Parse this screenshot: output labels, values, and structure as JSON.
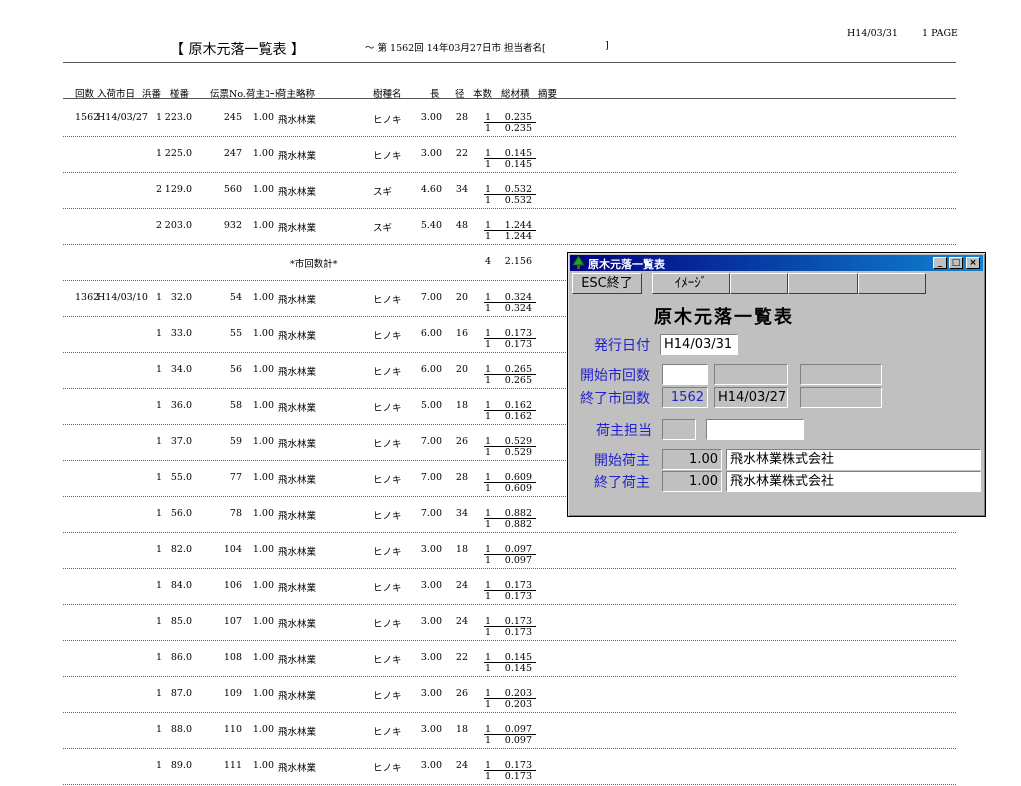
{
  "report": {
    "title": "【 原木元落一覧表 】",
    "subtitle": "～ 第 1562回 14年03月27日市 担当者名[",
    "subtitle_end": "]",
    "print_date": "H14/03/31",
    "page": "1 PAGE"
  },
  "columns": [
    "回数",
    "入荷市日",
    "浜番",
    "椪番",
    "伝票No.",
    "荷主ｺｰﾄﾞ",
    "荷主略称",
    "樹種名",
    "長",
    "径",
    "本数",
    "総材積",
    "摘要"
  ],
  "rows": [
    {
      "kai": "1562",
      "date": "H14/03/27",
      "hama": "1",
      "hai": "223.0",
      "den": "245",
      "code": "1.00",
      "name": "飛水林業",
      "species": "ヒノキ",
      "len": "3.00",
      "dia": "28",
      "qty": "1",
      "vol": "0.235",
      "qty2": "1",
      "vol2": "0.235"
    },
    {
      "kai": "",
      "date": "",
      "hama": "1",
      "hai": "225.0",
      "den": "247",
      "code": "1.00",
      "name": "飛水林業",
      "species": "ヒノキ",
      "len": "3.00",
      "dia": "22",
      "qty": "1",
      "vol": "0.145",
      "qty2": "1",
      "vol2": "0.145"
    },
    {
      "kai": "",
      "date": "",
      "hama": "2",
      "hai": "129.0",
      "den": "560",
      "code": "1.00",
      "name": "飛水林業",
      "species": "スギ",
      "len": "4.60",
      "dia": "34",
      "qty": "1",
      "vol": "0.532",
      "qty2": "1",
      "vol2": "0.532"
    },
    {
      "kai": "",
      "date": "",
      "hama": "2",
      "hai": "203.0",
      "den": "932",
      "code": "1.00",
      "name": "飛水林業",
      "species": "スギ",
      "len": "5.40",
      "dia": "48",
      "qty": "1",
      "vol": "1.244",
      "qty2": "1",
      "vol2": "1.244"
    },
    {
      "subtotal": true,
      "label": "*市回数計*",
      "qty": "4",
      "vol": "2.156"
    },
    {
      "kai": "1362",
      "date": "H14/03/10",
      "hama": "1",
      "hai": "32.0",
      "den": "54",
      "code": "1.00",
      "name": "飛水林業",
      "species": "ヒノキ",
      "len": "7.00",
      "dia": "20",
      "qty": "1",
      "vol": "0.324",
      "qty2": "1",
      "vol2": "0.324"
    },
    {
      "kai": "",
      "date": "",
      "hama": "1",
      "hai": "33.0",
      "den": "55",
      "code": "1.00",
      "name": "飛水林業",
      "species": "ヒノキ",
      "len": "6.00",
      "dia": "16",
      "qty": "1",
      "vol": "0.173",
      "qty2": "1",
      "vol2": "0.173"
    },
    {
      "kai": "",
      "date": "",
      "hama": "1",
      "hai": "34.0",
      "den": "56",
      "code": "1.00",
      "name": "飛水林業",
      "species": "ヒノキ",
      "len": "6.00",
      "dia": "20",
      "qty": "1",
      "vol": "0.265",
      "qty2": "1",
      "vol2": "0.265"
    },
    {
      "kai": "",
      "date": "",
      "hama": "1",
      "hai": "36.0",
      "den": "58",
      "code": "1.00",
      "name": "飛水林業",
      "species": "ヒノキ",
      "len": "5.00",
      "dia": "18",
      "qty": "1",
      "vol": "0.162",
      "qty2": "1",
      "vol2": "0.162"
    },
    {
      "kai": "",
      "date": "",
      "hama": "1",
      "hai": "37.0",
      "den": "59",
      "code": "1.00",
      "name": "飛水林業",
      "species": "ヒノキ",
      "len": "7.00",
      "dia": "26",
      "qty": "1",
      "vol": "0.529",
      "qty2": "1",
      "vol2": "0.529"
    },
    {
      "kai": "",
      "date": "",
      "hama": "1",
      "hai": "55.0",
      "den": "77",
      "code": "1.00",
      "name": "飛水林業",
      "species": "ヒノキ",
      "len": "7.00",
      "dia": "28",
      "qty": "1",
      "vol": "0.609",
      "qty2": "1",
      "vol2": "0.609"
    },
    {
      "kai": "",
      "date": "",
      "hama": "1",
      "hai": "56.0",
      "den": "78",
      "code": "1.00",
      "name": "飛水林業",
      "species": "ヒノキ",
      "len": "7.00",
      "dia": "34",
      "qty": "1",
      "vol": "0.882",
      "qty2": "1",
      "vol2": "0.882"
    },
    {
      "kai": "",
      "date": "",
      "hama": "1",
      "hai": "82.0",
      "den": "104",
      "code": "1.00",
      "name": "飛水林業",
      "species": "ヒノキ",
      "len": "3.00",
      "dia": "18",
      "qty": "1",
      "vol": "0.097",
      "qty2": "1",
      "vol2": "0.097"
    },
    {
      "kai": "",
      "date": "",
      "hama": "1",
      "hai": "84.0",
      "den": "106",
      "code": "1.00",
      "name": "飛水林業",
      "species": "ヒノキ",
      "len": "3.00",
      "dia": "24",
      "qty": "1",
      "vol": "0.173",
      "qty2": "1",
      "vol2": "0.173"
    },
    {
      "kai": "",
      "date": "",
      "hama": "1",
      "hai": "85.0",
      "den": "107",
      "code": "1.00",
      "name": "飛水林業",
      "species": "ヒノキ",
      "len": "3.00",
      "dia": "24",
      "qty": "1",
      "vol": "0.173",
      "qty2": "1",
      "vol2": "0.173"
    },
    {
      "kai": "",
      "date": "",
      "hama": "1",
      "hai": "86.0",
      "den": "108",
      "code": "1.00",
      "name": "飛水林業",
      "species": "ヒノキ",
      "len": "3.00",
      "dia": "22",
      "qty": "1",
      "vol": "0.145",
      "qty2": "1",
      "vol2": "0.145"
    },
    {
      "kai": "",
      "date": "",
      "hama": "1",
      "hai": "87.0",
      "den": "109",
      "code": "1.00",
      "name": "飛水林業",
      "species": "ヒノキ",
      "len": "3.00",
      "dia": "26",
      "qty": "1",
      "vol": "0.203",
      "qty2": "1",
      "vol2": "0.203"
    },
    {
      "kai": "",
      "date": "",
      "hama": "1",
      "hai": "88.0",
      "den": "110",
      "code": "1.00",
      "name": "飛水林業",
      "species": "ヒノキ",
      "len": "3.00",
      "dia": "18",
      "qty": "1",
      "vol": "0.097",
      "qty2": "1",
      "vol2": "0.097"
    },
    {
      "kai": "",
      "date": "",
      "hama": "1",
      "hai": "89.0",
      "den": "111",
      "code": "1.00",
      "name": "飛水林業",
      "species": "ヒノキ",
      "len": "3.00",
      "dia": "24",
      "qty": "1",
      "vol": "0.173",
      "qty2": "1",
      "vol2": "0.173"
    }
  ],
  "dialog": {
    "window_title": "原木元落一覧表",
    "minimize": "_",
    "maximize": "□",
    "close": "×",
    "esc_button": "ESC終了",
    "image_button": "ｲﾒｰｼﾞ",
    "heading": "原木元落一覧表",
    "issue_date_label": "発行日付",
    "issue_date_value": "H14/03/31",
    "start_count_label": "開始市回数",
    "start_count_value": "",
    "end_count_label": "終了市回数",
    "end_count_value": "1562",
    "end_date_value": "H14/03/27",
    "shipper_staff_label": "荷主担当",
    "shipper_staff_code": "",
    "shipper_staff_name": "",
    "start_shipper_label": "開始荷主",
    "start_shipper_code": "1.00",
    "start_shipper_name": "飛水林業株式会社",
    "end_shipper_label": "終了荷主",
    "end_shipper_code": "1.00",
    "end_shipper_name": "飛水林業株式会社"
  }
}
